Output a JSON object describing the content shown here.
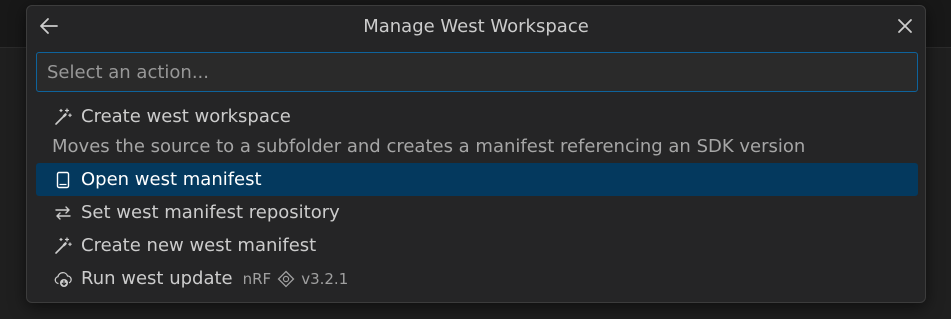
{
  "dialog": {
    "title": "Manage West Workspace",
    "back_icon": "arrow-left-icon",
    "close_icon": "close-icon"
  },
  "search": {
    "placeholder": "Select an action...",
    "value": ""
  },
  "items": [
    {
      "label": "Create west workspace",
      "icon": "sparkle-wand-icon",
      "detail": "Moves the source to a subfolder and creates a manifest referencing an SDK version",
      "selected": false
    },
    {
      "label": "Open west manifest",
      "icon": "file-icon",
      "selected": true
    },
    {
      "label": "Set west manifest repository",
      "icon": "arrows-swap-icon",
      "selected": false
    },
    {
      "label": "Create new west manifest",
      "icon": "sparkle-wand-icon",
      "selected": false
    },
    {
      "label": "Run west update",
      "icon": "cloud-download-icon",
      "desc_prefix": "nRF",
      "desc_icon": "tag-icon",
      "desc_version": "v3.2.1",
      "selected": false
    }
  ],
  "colors": {
    "accent": "#0e639c",
    "selection": "#04395e",
    "background": "#252526"
  }
}
